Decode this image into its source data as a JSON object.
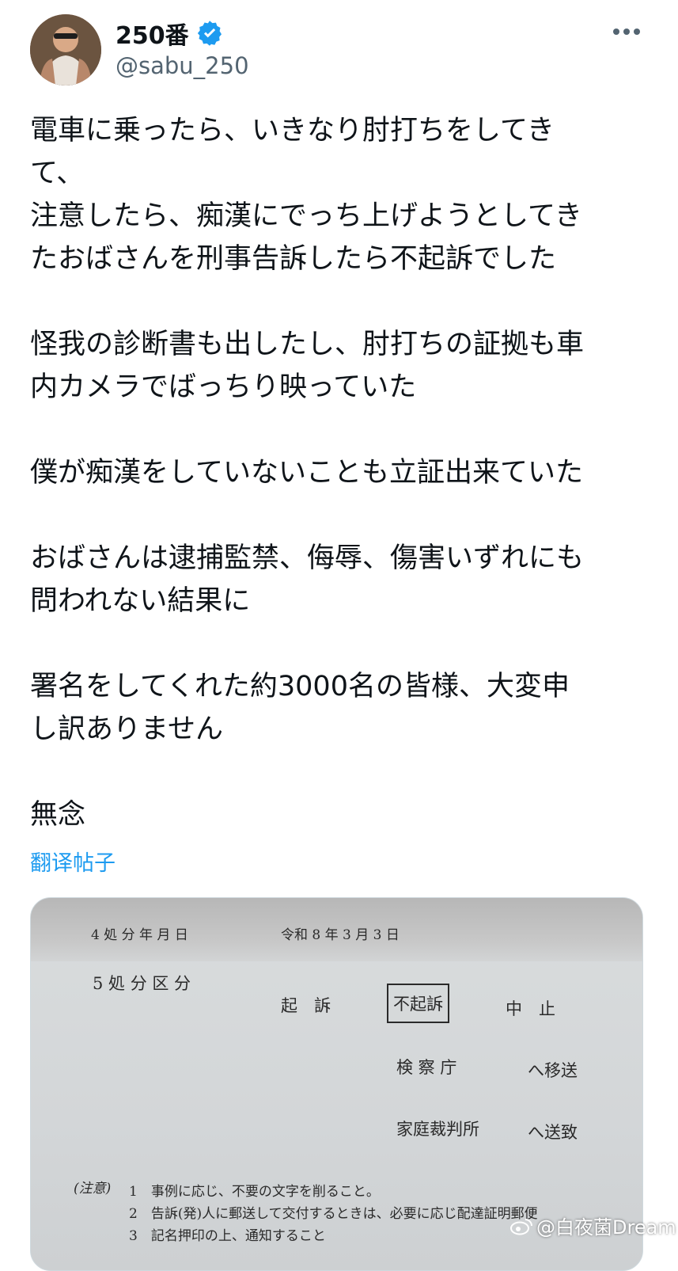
{
  "author": {
    "display_name": "250番",
    "handle": "@sabu_250",
    "verified_color": "#1d9bf0"
  },
  "tweet": {
    "lines": [
      "電車に乗ったら、いきなり肘打ちをしてき",
      "て、",
      "注意したら、痴漢にでっち上げようとしてき",
      "たおばさんを刑事告訴したら不起訴でした",
      "",
      "怪我の診断書も出したし、肘打ちの証拠も車",
      "内カメラでばっちり映っていた",
      "",
      "僕が痴漢をしていないことも立証出来ていた",
      "",
      "おばさんは逮捕監禁、侮辱、傷害いずれにも",
      "問われない結果に",
      "",
      "署名をしてくれた約3000名の皆様、大変申",
      "し訳ありません",
      "",
      "無念"
    ],
    "translate_label": "翻译帖子"
  },
  "document": {
    "row4_label": "4 処 分 年 月 日",
    "date_text": "令和 8 年 3 月 3 日",
    "row5_label": "5 処 分 区 分",
    "kiso": "起　訴",
    "fukiso": "不起訴",
    "chushi": "中　止",
    "kensatsucho": "検 察 庁",
    "isou": "へ移送",
    "katei": "家庭裁判所",
    "souchi": "へ送致",
    "note_label": "(注意)",
    "note1": "1　事例に応じ、不要の文字を削ること。",
    "note2": "2　告訴(発)人に郵送して交付するときは、必要に応じ配達証明郵便",
    "note3": "3　記名押印の上、通知すること"
  },
  "watermark": "@白夜菌Dream"
}
